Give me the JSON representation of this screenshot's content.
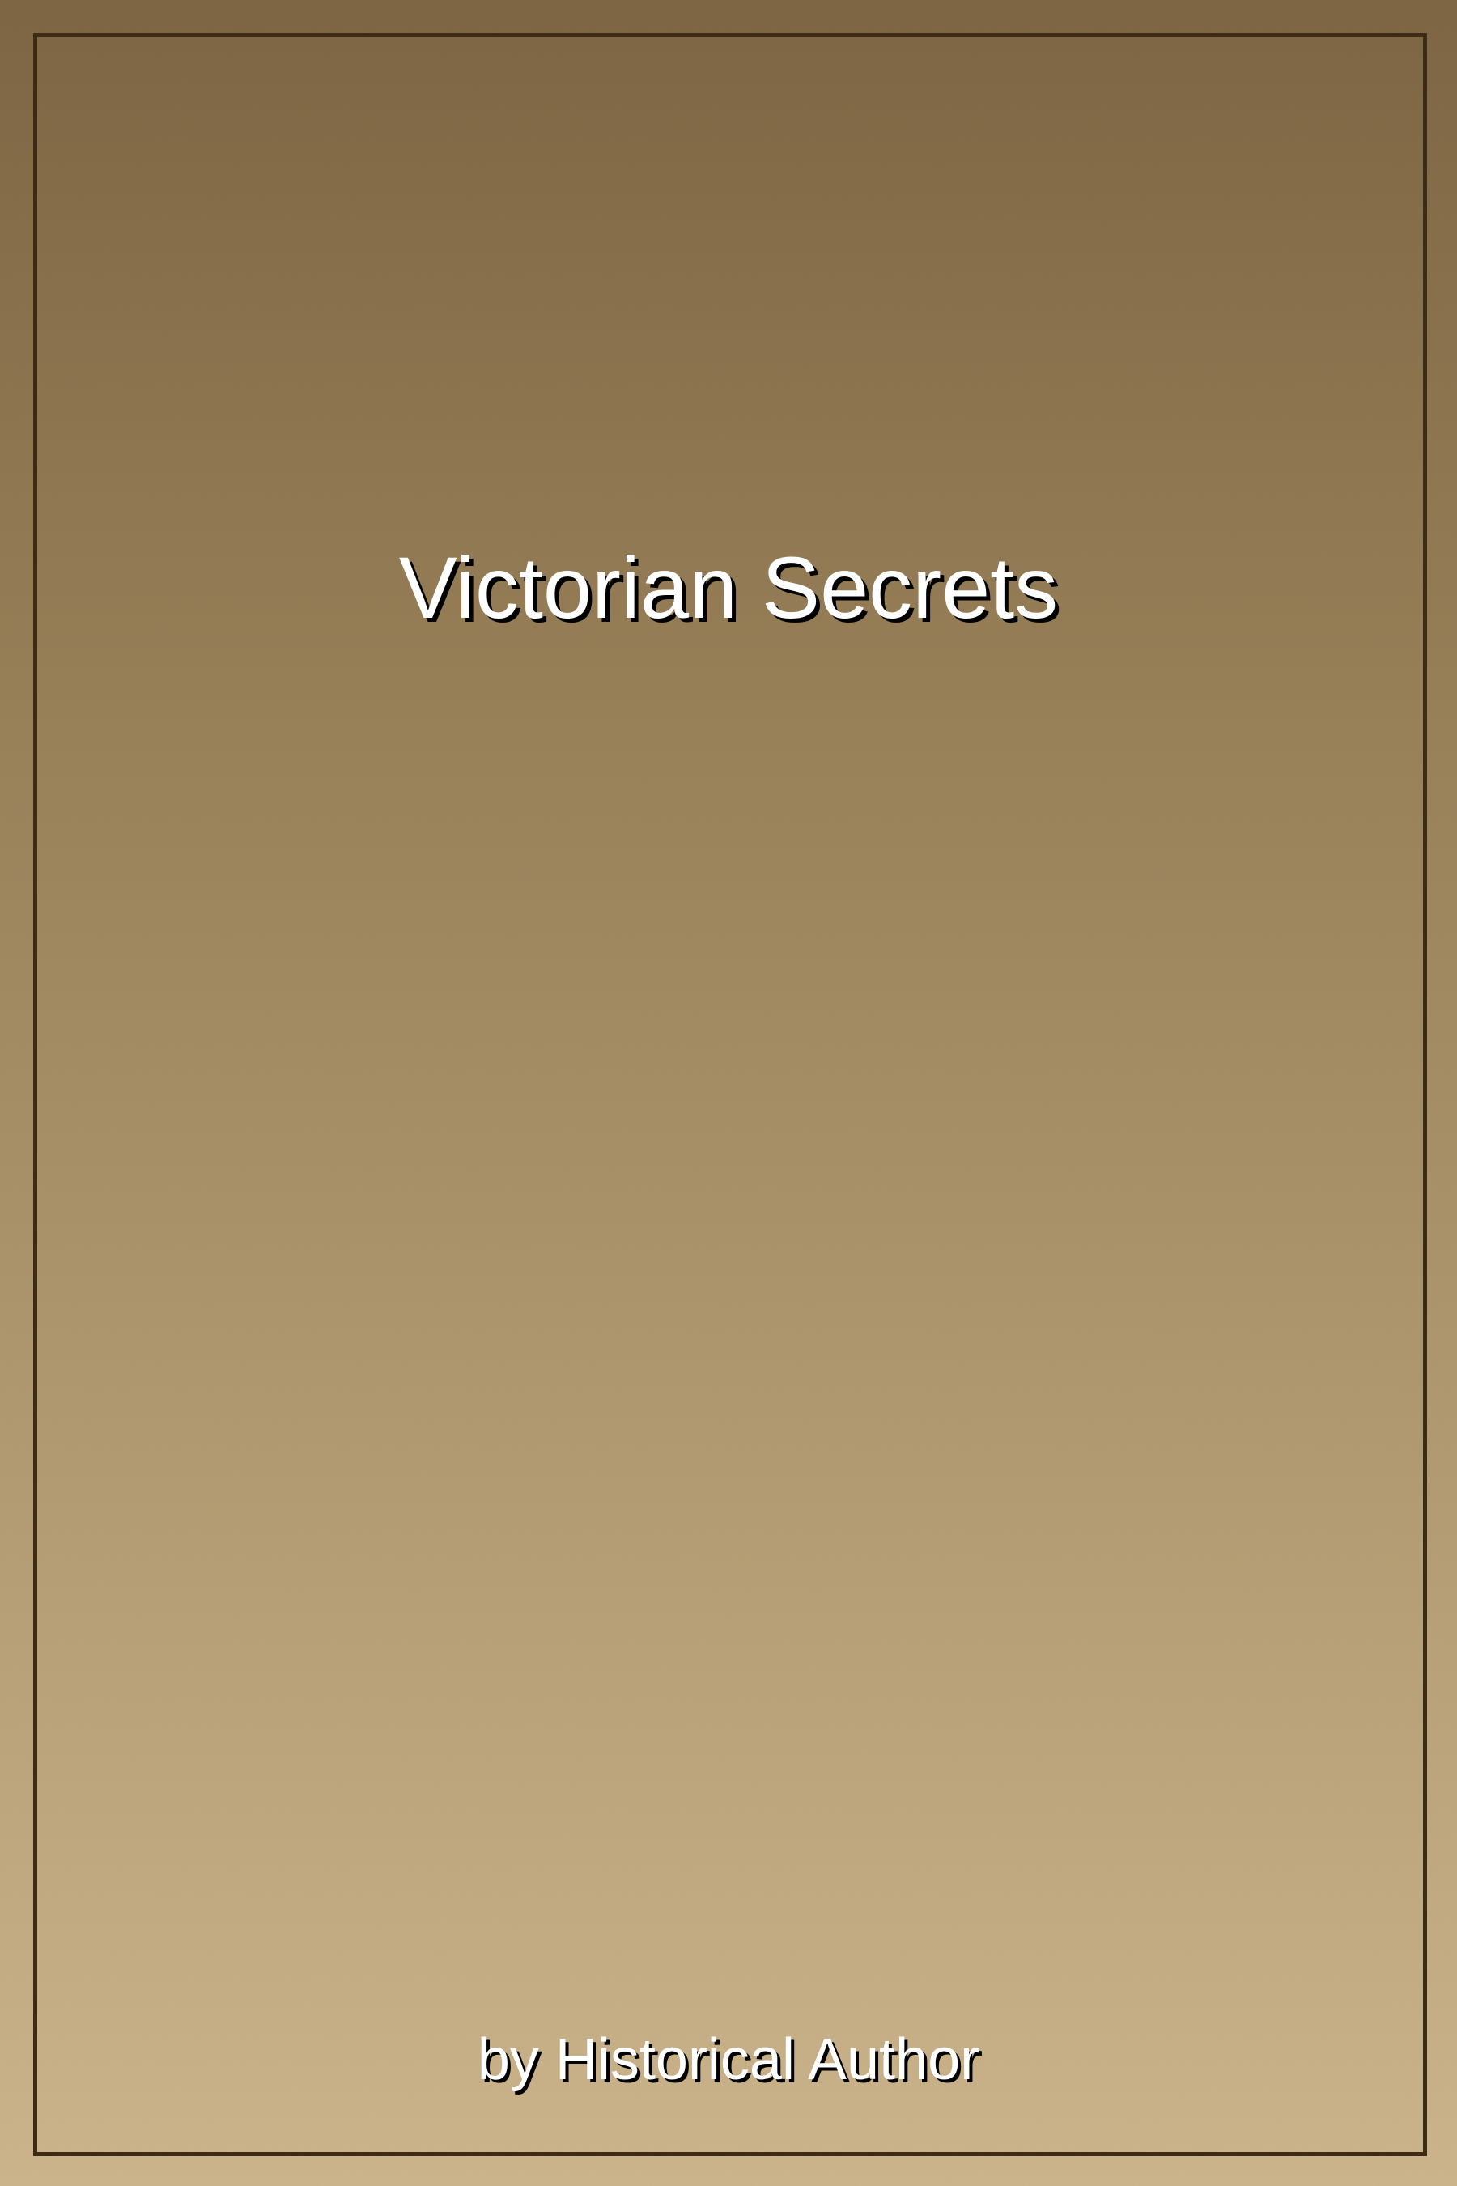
{
  "cover": {
    "title": "Victorian Secrets",
    "author_line": "by Historical Author"
  },
  "colors": {
    "gradient_top": "#7b6240",
    "gradient_bottom": "#d0b88e",
    "frame_border": "#3d2b14",
    "text": "#ffffff",
    "text_shadow": "#000000"
  }
}
